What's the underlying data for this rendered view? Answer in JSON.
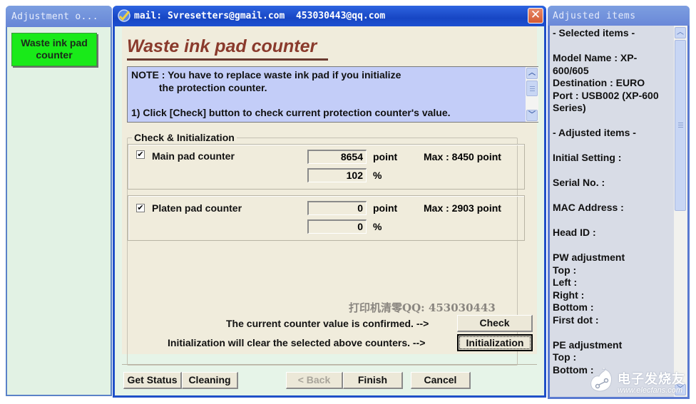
{
  "left_panel": {
    "title": "Adjustment o...",
    "selected_item": "Waste ink pad counter",
    "selected_color": "#19ea19"
  },
  "window": {
    "title": "mail: Svresetters@gmail.com  453030443@qq.com",
    "close_icon": "close-icon"
  },
  "heading": "Waste ink pad counter",
  "note": {
    "line1": "NOTE : You have to replace waste ink pad if you initialize",
    "line2": "          the protection counter.",
    "line3": "1) Click [Check] button to check current protection counter's value."
  },
  "group": {
    "label": "Check & Initialization",
    "counters": [
      {
        "label": "Main pad counter",
        "checked": true,
        "point_value": "8654",
        "point_unit": "point",
        "percent_value": "102",
        "percent_unit": "%",
        "max": "Max : 8450 point"
      },
      {
        "label": "Platen pad counter",
        "checked": true,
        "point_value": "0",
        "point_unit": "point",
        "percent_value": "0",
        "percent_unit": "%",
        "max": "Max : 2903 point"
      }
    ],
    "checkmark": "✔"
  },
  "watermark_qq": "打印机清零QQ: 453030443",
  "actions": {
    "check_message": "The current counter value is confirmed. -->",
    "check_button": "Check",
    "init_message": "Initialization will clear the selected above counters. -->",
    "init_button": "Initialization"
  },
  "footer": {
    "get_status": "Get Status",
    "cleaning": "Cleaning",
    "back": "< Back",
    "finish": "Finish",
    "cancel": "Cancel"
  },
  "right_panel": {
    "title": "Adjusted items",
    "lines": [
      "- Selected items -",
      "",
      "Model Name : XP-600/605",
      "Destination : EURO",
      "Port : USB002 (XP-600 Series)",
      "",
      "- Adjusted items -",
      "",
      "Initial Setting :",
      "",
      "Serial No. :",
      "",
      "MAC Address :",
      "",
      "Head ID :",
      "",
      "PW adjustment",
      "Top :",
      "Left :",
      "Right :",
      "Bottom :",
      "First dot :",
      "",
      "PE adjustment",
      "Top :",
      "Bottom :"
    ]
  },
  "site_watermark": {
    "cn": "电子发烧友",
    "url": "www.elecfans.com"
  }
}
